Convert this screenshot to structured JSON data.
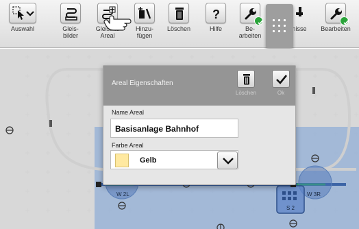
{
  "toolbar": {
    "items": [
      {
        "name": "auswahl",
        "label": "Auswahl",
        "icon": "selection-dropdown-icon"
      },
      {
        "name": "gleisbilder",
        "label": "Gleis-\nbilder",
        "icon": "track-layout-icon"
      },
      {
        "name": "gleisbild-areal",
        "label": "Gleisbild\nAreal",
        "icon": "track-area-icon"
      },
      {
        "name": "hinzufuegen",
        "label": "Hinzu-\nfügen",
        "icon": "add-icon"
      },
      {
        "name": "loeschen",
        "label": "Löschen",
        "icon": "trash-icon"
      },
      {
        "name": "hilfe",
        "label": "Hilfe",
        "icon": "help-icon"
      },
      {
        "name": "bearbeiten-1",
        "label": "Be-\narbeiten",
        "icon": "wrench-icon"
      },
      {
        "name": "menu-grid",
        "label": "",
        "icon": "grid-menu-icon"
      },
      {
        "name": "ereignisse",
        "label": "nisse",
        "icon": "events-icon"
      },
      {
        "name": "bearbeiten-2",
        "label": "Bearbeiten",
        "icon": "wrench-icon"
      }
    ]
  },
  "dialog": {
    "title": "Areal Eigenschaften",
    "delete_label": "Löschen",
    "ok_label": "Ok",
    "name_label": "Name Areal",
    "name_value": "Basisanlage Bahnhof",
    "color_label": "Farbe Areal",
    "color_value": "Gelb",
    "color_swatch": "#ffe9a0"
  },
  "layout": {
    "signals": [
      "W 2L",
      "W 3R",
      "S 2"
    ]
  },
  "colors": {
    "area_fill": "#78a0d7",
    "track": "#c8c8c8",
    "ok_badge": "#2aa43a",
    "dialog_header": "#959595"
  }
}
